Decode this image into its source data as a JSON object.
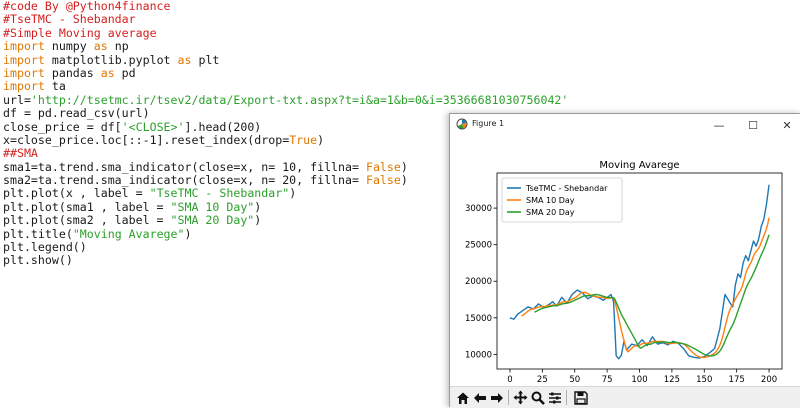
{
  "code": {
    "lines": [
      [
        {
          "t": "#code By @Python4finance",
          "c": "cmt"
        }
      ],
      [
        {
          "t": "#TseTMC - Shebandar",
          "c": "cmt"
        }
      ],
      [
        {
          "t": "#Simple Moving average",
          "c": "cmt"
        }
      ],
      [
        {
          "t": "import",
          "c": "kw"
        },
        {
          "t": " numpy ",
          "c": ""
        },
        {
          "t": "as",
          "c": "kw"
        },
        {
          "t": " np",
          "c": ""
        }
      ],
      [
        {
          "t": "import",
          "c": "kw"
        },
        {
          "t": " matplotlib.pyplot ",
          "c": ""
        },
        {
          "t": "as",
          "c": "kw"
        },
        {
          "t": " plt",
          "c": ""
        }
      ],
      [
        {
          "t": "import",
          "c": "kw"
        },
        {
          "t": " pandas ",
          "c": ""
        },
        {
          "t": "as",
          "c": "kw"
        },
        {
          "t": " pd",
          "c": ""
        }
      ],
      [
        {
          "t": "import",
          "c": "kw"
        },
        {
          "t": " ta",
          "c": ""
        }
      ],
      [
        {
          "t": "url=",
          "c": ""
        },
        {
          "t": "'http://tsetmc.ir/tsev2/data/Export-txt.aspx?t=i&a=1&b=0&i=35366681030756042'",
          "c": "str"
        }
      ],
      [
        {
          "t": "df = pd.read_csv(url)",
          "c": ""
        }
      ],
      [
        {
          "t": "close_price = df[",
          "c": ""
        },
        {
          "t": "'<CLOSE>'",
          "c": "str"
        },
        {
          "t": "].head(200)",
          "c": ""
        }
      ],
      [
        {
          "t": "x=close_price.loc[::-1].reset_index(drop=",
          "c": ""
        },
        {
          "t": "True",
          "c": "kw"
        },
        {
          "t": ")",
          "c": ""
        }
      ],
      [
        {
          "t": "##SMA",
          "c": "cmt"
        }
      ],
      [
        {
          "t": "sma1=ta.trend.sma_indicator(close=x, n= 10, fillna= ",
          "c": ""
        },
        {
          "t": "False",
          "c": "kw"
        },
        {
          "t": ")",
          "c": ""
        }
      ],
      [
        {
          "t": "sma2=ta.trend.sma_indicator(close=x, n= 20, fillna= ",
          "c": ""
        },
        {
          "t": "False",
          "c": "kw"
        },
        {
          "t": ")",
          "c": ""
        }
      ],
      [
        {
          "t": "plt.plot(x , label = ",
          "c": ""
        },
        {
          "t": "\"TseTMC - Shebandar\"",
          "c": "str"
        },
        {
          "t": ")",
          "c": ""
        }
      ],
      [
        {
          "t": "plt.plot(sma1 , label = ",
          "c": ""
        },
        {
          "t": "\"SMA 10 Day\"",
          "c": "str"
        },
        {
          "t": ")",
          "c": ""
        }
      ],
      [
        {
          "t": "plt.plot(sma2 , label = ",
          "c": ""
        },
        {
          "t": "\"SMA 20 Day\"",
          "c": "str"
        },
        {
          "t": ")",
          "c": ""
        }
      ],
      [
        {
          "t": "plt.title(",
          "c": ""
        },
        {
          "t": "\"Moving Avarege\"",
          "c": "str"
        },
        {
          "t": ")",
          "c": ""
        }
      ],
      [
        {
          "t": "plt.legend()",
          "c": ""
        }
      ],
      [
        {
          "t": "plt.show()",
          "c": ""
        }
      ]
    ]
  },
  "window": {
    "title": "Figure 1",
    "minimize": "—",
    "maximize": "☐",
    "close": "✕"
  },
  "toolbar": {
    "icons": [
      "home-icon",
      "back-arrow-icon",
      "forward-arrow-icon",
      "pan-icon",
      "zoom-icon",
      "configure-subplots-icon",
      "save-icon"
    ]
  },
  "chart_data": {
    "type": "line",
    "title": "Moving Avarege",
    "xlabel": "",
    "ylabel": "",
    "xlim": [
      -10,
      210
    ],
    "ylim": [
      8000,
      34800
    ],
    "xticks": [
      0,
      25,
      50,
      75,
      100,
      125,
      150,
      175,
      200
    ],
    "yticks": [
      10000,
      15000,
      20000,
      25000,
      30000
    ],
    "legend_position": "top-left",
    "grid": false,
    "anchors": {
      "x": [
        0,
        3,
        6,
        10,
        14,
        18,
        22,
        26,
        30,
        33,
        36,
        40,
        44,
        48,
        52,
        56,
        60,
        64,
        68,
        72,
        76,
        78,
        80,
        82,
        84,
        86,
        88,
        90,
        94,
        98,
        102,
        106,
        110,
        114,
        118,
        122,
        126,
        130,
        134,
        138,
        142,
        146,
        150,
        154,
        158,
        162,
        166,
        170,
        172,
        174,
        176,
        178,
        180,
        182,
        184,
        186,
        188,
        190,
        192,
        194,
        196,
        198,
        200
      ],
      "y": [
        15000,
        14800,
        15500,
        16000,
        16500,
        16200,
        16900,
        16400,
        16800,
        17200,
        16600,
        17800,
        17000,
        18200,
        18800,
        18400,
        17600,
        18000,
        17800,
        17400,
        17900,
        18200,
        17200,
        9800,
        9400,
        9900,
        11800,
        10600,
        11400,
        11200,
        12000,
        11200,
        12400,
        11400,
        11600,
        11300,
        11800,
        11500,
        10800,
        9800,
        9600,
        9500,
        9700,
        10200,
        10800,
        13500,
        18200,
        17000,
        16500,
        19500,
        21000,
        20500,
        22500,
        23500,
        22800,
        24200,
        25500,
        24800,
        25800,
        27500,
        28500,
        30500,
        33200
      ]
    },
    "series": [
      {
        "name": "TseTMC - Shebandar",
        "color": "#1f77b4"
      },
      {
        "name": "SMA 10 Day",
        "color": "#ff7f0e"
      },
      {
        "name": "SMA 20 Day",
        "color": "#2ca02c"
      }
    ]
  }
}
